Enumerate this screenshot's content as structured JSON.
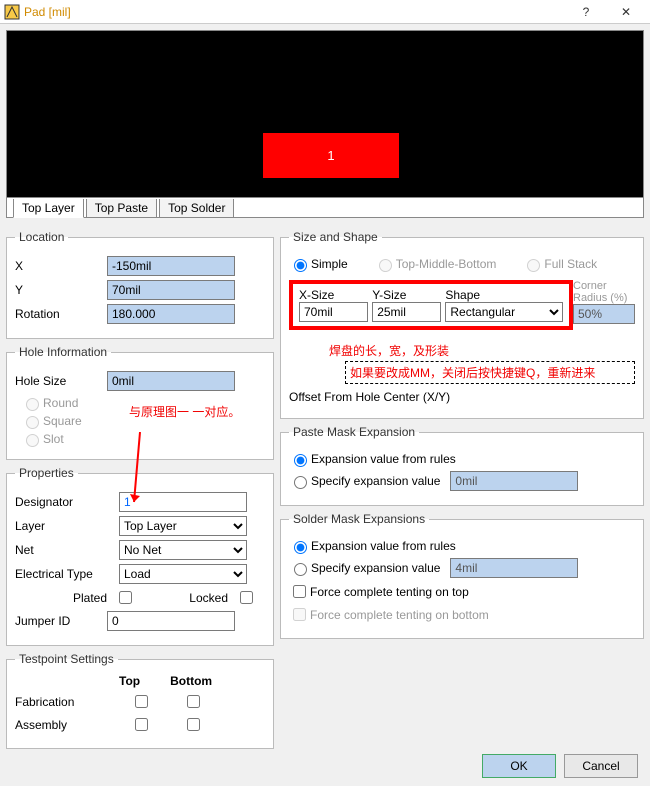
{
  "title": "Pad [mil]",
  "help_icon": "?",
  "close_icon": "✕",
  "pad_label": "1",
  "tabs": {
    "topLayer": "Top Layer",
    "topPaste": "Top Paste",
    "topSolder": "Top Solder"
  },
  "location": {
    "legend": "Location",
    "x_label": "X",
    "x": "-150mil",
    "y_label": "Y",
    "y": "70mil",
    "rot_label": "Rotation",
    "rot": "180.000"
  },
  "hole": {
    "legend": "Hole Information",
    "size_label": "Hole Size",
    "size": "0mil",
    "round": "Round",
    "square": "Square",
    "slot": "Slot"
  },
  "annot": {
    "left": "与原理图一 一对应。",
    "size": "焊盘的长，宽，及形装",
    "mm": "如果要改成MM，关闭后按快捷键Q，重新进来"
  },
  "props": {
    "legend": "Properties",
    "designator_label": "Designator",
    "designator": "1",
    "layer_label": "Layer",
    "layer": "Top Layer",
    "net_label": "Net",
    "net": "No Net",
    "etype_label": "Electrical Type",
    "etype": "Load",
    "plated": "Plated",
    "locked": "Locked",
    "jumper_label": "Jumper ID",
    "jumper": "0"
  },
  "testpoint": {
    "legend": "Testpoint Settings",
    "top": "Top",
    "bottom": "Bottom",
    "fabrication": "Fabrication",
    "assembly": "Assembly"
  },
  "sizeShape": {
    "legend": "Size and Shape",
    "simple": "Simple",
    "tmb": "Top-Middle-Bottom",
    "full": "Full Stack",
    "xsize_h": "X-Size",
    "ysize_h": "Y-Size",
    "shape_h": "Shape",
    "radius_h": "Corner Radius (%)",
    "xsize": "70mil",
    "ysize": "25mil",
    "shape": "Rectangular",
    "radius": "50%",
    "offset_label": "Offset From Hole Center (X/Y)"
  },
  "pasteMask": {
    "legend": "Paste Mask Expansion",
    "rules": "Expansion value from rules",
    "specify": "Specify expansion value",
    "value": "0mil"
  },
  "solderMask": {
    "legend": "Solder Mask Expansions",
    "rules": "Expansion value from rules",
    "specify": "Specify expansion value",
    "value": "4mil",
    "tentTop": "Force complete tenting on top",
    "tentBottom": "Force complete tenting on bottom"
  },
  "buttons": {
    "ok": "OK",
    "cancel": "Cancel"
  }
}
